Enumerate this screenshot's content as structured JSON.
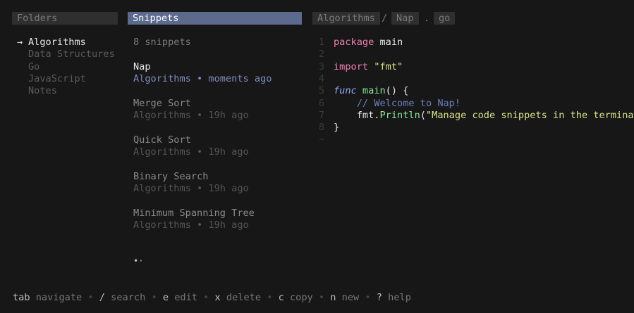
{
  "folders_pane": {
    "header": "Folders",
    "active_marker": "→",
    "items": [
      {
        "label": "Algorithms",
        "active": true
      },
      {
        "label": "Data Structures",
        "active": false
      },
      {
        "label": "Go",
        "active": false
      },
      {
        "label": "JavaScript",
        "active": false
      },
      {
        "label": "Notes",
        "active": false
      }
    ]
  },
  "snippets_pane": {
    "header": "Snippets",
    "count_label": "8 snippets",
    "items": [
      {
        "title": "Nap",
        "meta": "Algorithms • moments ago",
        "selected": true
      },
      {
        "title": "Merge Sort",
        "meta": "Algorithms • 19h ago",
        "selected": false
      },
      {
        "title": "Quick Sort",
        "meta": "Algorithms • 19h ago",
        "selected": false
      },
      {
        "title": "Binary Search",
        "meta": "Algorithms • 19h ago",
        "selected": false
      },
      {
        "title": "Minimum Spanning Tree",
        "meta": "Algorithms • 19h ago",
        "selected": false
      }
    ],
    "pager": "•·"
  },
  "code_pane": {
    "breadcrumb": {
      "folder": "Algorithms",
      "separator": "/",
      "name": "Nap",
      "dot": ".",
      "extension": "go"
    },
    "line_numbers": [
      "1",
      "2",
      "3",
      "4",
      "5",
      "6",
      "7",
      "8",
      "~"
    ],
    "lines": {
      "l1_kw": "package",
      "l1_rest": " main",
      "l3_kw": "import",
      "l3_str": " \"fmt\"",
      "l5_kw": "func",
      "l5_fn": " main",
      "l5_rest": "() {",
      "l6_comment": "    // Welcome to Nap!",
      "l7_pkg": "    fmt.",
      "l7_method": "Println",
      "l7_open": "(",
      "l7_str": "\"Manage code snippets in the terminal\"",
      "l7_close": ")",
      "l8": "}"
    }
  },
  "footer": {
    "items": [
      {
        "key": "tab",
        "desc": "navigate"
      },
      {
        "key": "/",
        "desc": "search"
      },
      {
        "key": "e",
        "desc": "edit"
      },
      {
        "key": "x",
        "desc": "delete"
      },
      {
        "key": "c",
        "desc": "copy"
      },
      {
        "key": "n",
        "desc": "new"
      },
      {
        "key": "?",
        "desc": "help"
      }
    ],
    "separator": "•"
  },
  "colors": {
    "background": "#171717",
    "snippets_header_bg": "#5c6a8e",
    "selected_meta": "#7f8bbd",
    "keyword": "#ec7fb1",
    "string": "#dce38c",
    "function": "#8ae89a",
    "comment": "#6f7fbf"
  }
}
